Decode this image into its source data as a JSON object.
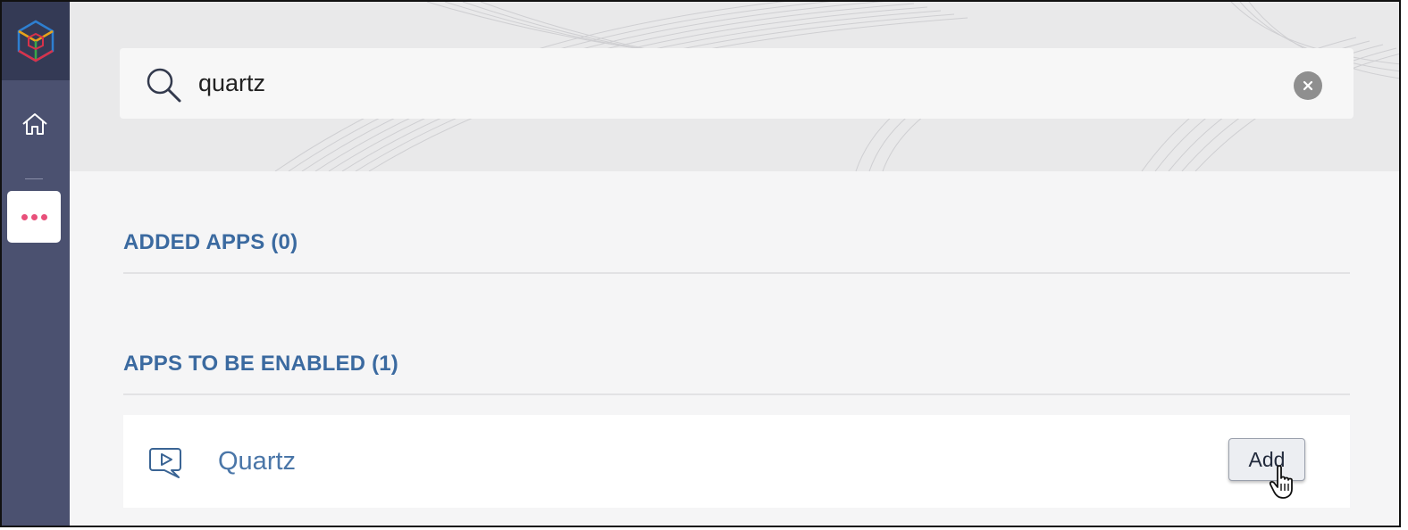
{
  "search": {
    "value": "quartz",
    "placeholder": ""
  },
  "sections": {
    "added": {
      "title": "ADDED APPS (0)"
    },
    "to_enable": {
      "title": "APPS TO BE ENABLED (1)"
    }
  },
  "apps": [
    {
      "name": "Quartz",
      "icon": "video-chat-icon",
      "action_label": "Add"
    }
  ],
  "colors": {
    "sidebar": "#4b5170",
    "sidebar_top": "#343a55",
    "accent_blue": "#3b6aa0",
    "more_dots": "#e8507a"
  },
  "icons": {
    "logo": "cube-logo-icon",
    "home": "home-icon",
    "more": "more-dots-icon",
    "search": "search-icon",
    "clear": "close-icon",
    "cursor": "hand-pointer-icon"
  }
}
